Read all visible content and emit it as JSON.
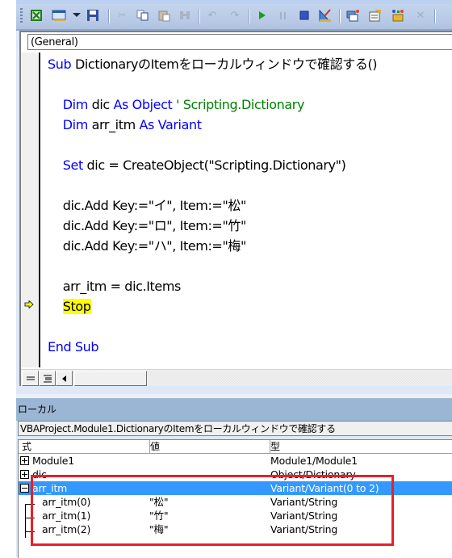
{
  "toolbar": {
    "icons": [
      "excel-icon",
      "userform-icon",
      "dropdown-arrow-icon",
      "save-icon",
      "cut-icon",
      "copy-icon",
      "paste-icon",
      "find-icon",
      "undo-icon",
      "redo-icon",
      "run-icon",
      "pause-icon",
      "reset-icon",
      "design-mode-icon",
      "project-explorer-icon",
      "properties-icon",
      "object-browser-icon",
      "toolbox-icon"
    ]
  },
  "code_window": {
    "procedure_dropdown": "(General)",
    "lines": [
      {
        "parts": [
          {
            "t": "Sub ",
            "k": "kw"
          },
          {
            "t": "DictionaryのItemをローカルウィンドウで確認する()",
            "k": ""
          }
        ]
      },
      {
        "parts": []
      },
      {
        "parts": [
          {
            "t": "    "
          },
          {
            "t": "Dim ",
            "k": "kw"
          },
          {
            "t": "dic "
          },
          {
            "t": "As Object ",
            "k": "kw"
          },
          {
            "t": "' Scripting.Dictionary",
            "k": "cm"
          }
        ]
      },
      {
        "parts": [
          {
            "t": "    "
          },
          {
            "t": "Dim ",
            "k": "kw"
          },
          {
            "t": "arr_itm "
          },
          {
            "t": "As Variant",
            "k": "kw"
          }
        ]
      },
      {
        "parts": []
      },
      {
        "parts": [
          {
            "t": "    "
          },
          {
            "t": "Set ",
            "k": "kw"
          },
          {
            "t": "dic = CreateObject(\"Scripting.Dictionary\")"
          }
        ]
      },
      {
        "parts": []
      },
      {
        "parts": [
          {
            "t": "    dic.Add Key:=\"イ\", Item:=\"松\""
          }
        ]
      },
      {
        "parts": [
          {
            "t": "    dic.Add Key:=\"ロ\", Item:=\"竹\""
          }
        ]
      },
      {
        "parts": [
          {
            "t": "    dic.Add Key:=\"ハ\", Item:=\"梅\""
          }
        ]
      },
      {
        "parts": []
      },
      {
        "parts": [
          {
            "t": "    arr_itm = dic.Items"
          }
        ]
      },
      {
        "parts": [
          {
            "t": "    "
          },
          {
            "t": "Stop",
            "k": "hl"
          }
        ]
      },
      {
        "parts": []
      },
      {
        "parts": [
          {
            "t": "End Sub",
            "k": "kw"
          }
        ]
      }
    ],
    "execution_line_index": 12
  },
  "locals": {
    "title": "ローカル",
    "context": "VBAProject.Module1.DictionaryのItemをローカルウィンドウで確認する",
    "columns": [
      "式",
      "値",
      "型"
    ],
    "rows": [
      {
        "expr": "Module1",
        "value": "",
        "type": "Module1/Module1",
        "expander": "plus",
        "child": false,
        "selected": false
      },
      {
        "expr": "dic",
        "value": "",
        "type": "Object/Dictionary",
        "expander": "plus",
        "child": false,
        "selected": false
      },
      {
        "expr": "arr_itm",
        "value": "",
        "type": "Variant/Variant(0 to 2)",
        "expander": "minus",
        "child": false,
        "selected": true
      },
      {
        "expr": "arr_itm(0)",
        "value": "\"松\"",
        "type": "Variant/String",
        "expander": "",
        "child": true,
        "selected": false
      },
      {
        "expr": "arr_itm(1)",
        "value": "\"竹\"",
        "type": "Variant/String",
        "expander": "",
        "child": true,
        "selected": false
      },
      {
        "expr": "arr_itm(2)",
        "value": "\"梅\"",
        "type": "Variant/String",
        "expander": "",
        "child": true,
        "selected": false
      }
    ]
  },
  "colors": {
    "keyword": "#0000ff",
    "comment": "#008000",
    "highlight": "#ffff00",
    "selection": "#3399ff",
    "annotation_box": "#e8202a"
  }
}
